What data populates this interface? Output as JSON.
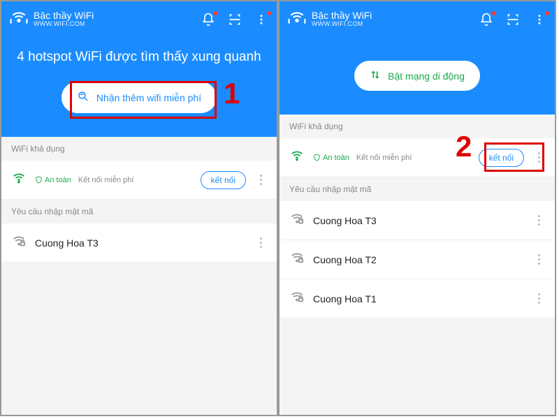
{
  "left": {
    "header": {
      "title": "Bậc thầy WiFi",
      "subtitle": "WWW.WIFI.COM"
    },
    "hero": {
      "title": "4 hotspot WiFi được tìm thấy xung quanh",
      "button": "Nhận thêm wifi miễn phí"
    },
    "section_available": "WiFi khả dụng",
    "available": {
      "safe": "An toàn",
      "free": "Kết nối miễn phí",
      "connect": "kết nối"
    },
    "section_password": "Yêu cầu nhập mật mã",
    "pw_items": [
      {
        "name": "Cuong Hoa T3"
      }
    ],
    "annot_num": "1"
  },
  "right": {
    "header": {
      "title": "Bậc thầy WiFi",
      "subtitle": "WWW.WIFI.COM"
    },
    "hero": {
      "button": "Bật mạng di động"
    },
    "section_available": "WiFi khả dụng",
    "available": {
      "safe": "An toàn",
      "free": "Kết nối miễn phí",
      "connect": "kết nối"
    },
    "section_password": "Yêu cầu nhập mật mã",
    "pw_items": [
      {
        "name": "Cuong Hoa T3"
      },
      {
        "name": "Cuong Hoa T2"
      },
      {
        "name": "Cuong Hoa T1"
      }
    ],
    "annot_num": "2"
  }
}
